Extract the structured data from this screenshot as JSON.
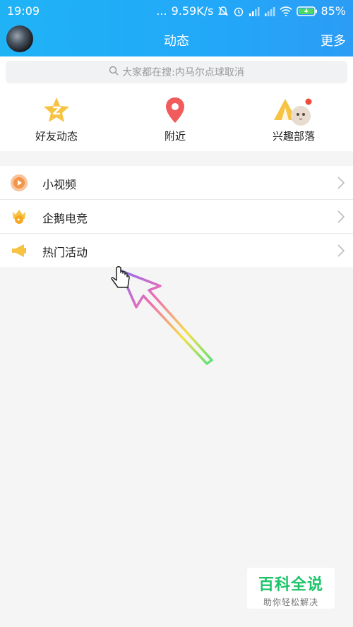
{
  "status_bar": {
    "time": "19:09",
    "dots": "...",
    "speed": "9.59K/s",
    "battery": "85%"
  },
  "header": {
    "title": "动态",
    "more": "更多"
  },
  "search": {
    "placeholder": "大家都在搜:内马尔点球取消"
  },
  "quick_entries": [
    {
      "label": "好友动态",
      "icon": "star-icon"
    },
    {
      "label": "附近",
      "icon": "location-pin-icon"
    },
    {
      "label": "兴趣部落",
      "icon": "tent-icon"
    }
  ],
  "list": [
    {
      "label": "小视频",
      "icon": "video-icon"
    },
    {
      "label": "企鹅电竞",
      "icon": "esports-crown-icon"
    },
    {
      "label": "热门活动",
      "icon": "megaphone-icon"
    }
  ],
  "watermark": {
    "title": "百科全说",
    "subtitle": "助你轻松解决"
  },
  "colors": {
    "header_start": "#1fb3f6",
    "header_end": "#2c9cf5",
    "watermark_green": "#1dc46a"
  }
}
